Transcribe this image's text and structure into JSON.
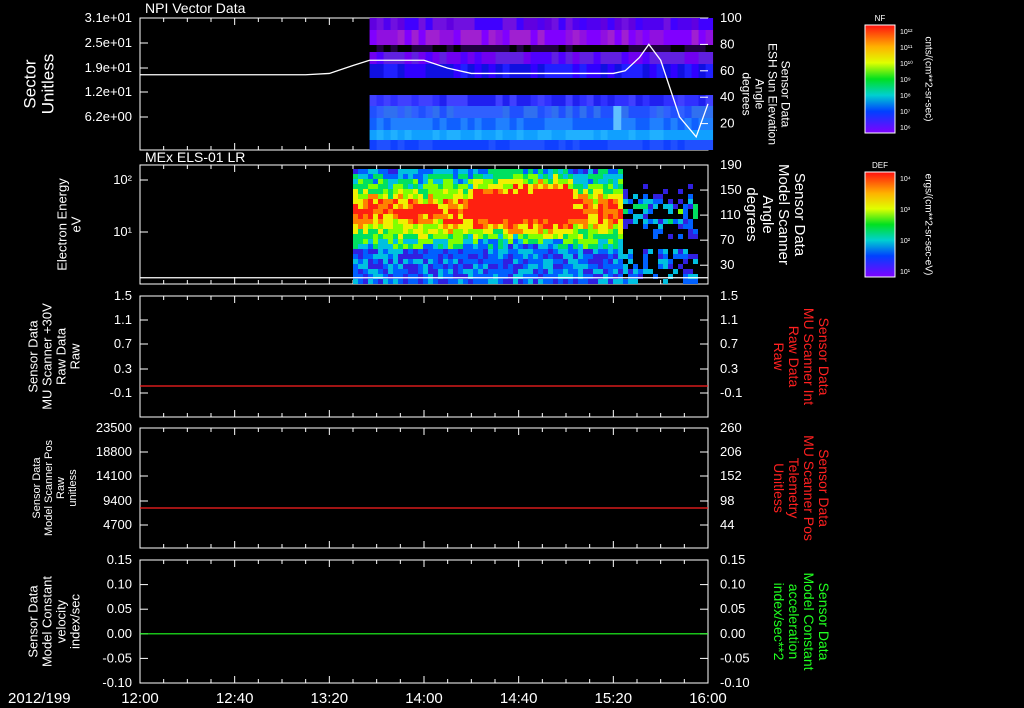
{
  "colors": {
    "background": "#000000",
    "axis": "#ffffff",
    "red_trace": "#ff2020",
    "green_trace": "#20ff20",
    "right_red_label": "#ff2020",
    "right_green_label": "#20ff20"
  },
  "chart_data": [
    {
      "type": "heatmap",
      "title": "NPI Vector Data",
      "ylabel": [
        "Sector",
        "Unitless"
      ],
      "yticks": [
        "3.1e+01",
        "2.5e+01",
        "1.9e+01",
        "1.2e+01",
        "6.2e+00"
      ],
      "right_ylabel": [
        "Sensor Data",
        "ESH Sun Elevation",
        "Angle",
        "degrees"
      ],
      "right_yticks": [
        "100",
        "80",
        "60",
        "40",
        "20"
      ],
      "right_ylim": [
        0,
        100
      ],
      "colorbar": {
        "label": "NF",
        "ticks": [
          "10¹²",
          "10¹¹",
          "10¹⁰",
          "10⁹",
          "10⁸",
          "10⁷",
          "10⁶"
        ],
        "unit": "cnts/(cm**2-sr-sec)"
      },
      "data_start_time": "13:37",
      "line": {
        "name": "Sun Elevation Angle",
        "times": [
          "12:00",
          "13:10",
          "13:20",
          "13:30",
          "13:37",
          "14:00",
          "14:10",
          "14:20",
          "15:20",
          "15:25",
          "15:31",
          "15:35",
          "15:40",
          "15:48",
          "15:55",
          "16:00"
        ],
        "values": [
          57,
          57,
          58,
          64,
          68,
          68,
          62,
          58,
          58,
          60,
          70,
          80,
          68,
          25,
          10,
          35
        ]
      }
    },
    {
      "type": "heatmap",
      "title": "MEx ELS-01 LR",
      "ylabel": [
        "Electron Energy",
        "eV"
      ],
      "yticks": [
        "10²",
        "10¹"
      ],
      "right_ylabel": [
        "Sensor Data",
        "Model Scanner",
        "Angle",
        "degrees"
      ],
      "right_yticks": [
        "190",
        "150",
        "110",
        "70",
        "30"
      ],
      "right_ylim": [
        0,
        190
      ],
      "colorbar": {
        "label": "DEF",
        "ticks": [
          "10⁴",
          "10³",
          "10²",
          "10¹"
        ],
        "unit": "ergs/(cm**2-sr-sec-eV)"
      },
      "data_start_time": "13:30",
      "line": {
        "name": "Model Scanner Angle",
        "value": 10
      }
    },
    {
      "type": "line",
      "ylabel": [
        "Sensor Data",
        "MU Scanner +30V",
        "Raw Data",
        "Raw"
      ],
      "yticks": [
        "1.5",
        "1.1",
        "0.7",
        "0.3",
        "-0.1"
      ],
      "ylim": [
        -0.3,
        1.5
      ],
      "right_ylabel": [
        "Sensor Data",
        "MU Scanner Int",
        "Raw Data",
        "Raw"
      ],
      "right_yticks": [
        "1.5",
        "1.1",
        "0.7",
        "0.3",
        "-0.1"
      ],
      "series": [
        {
          "value": 0.0,
          "color": "#ff2020"
        }
      ]
    },
    {
      "type": "line",
      "ylabel": [
        "Sensor Data",
        "Model Scanner Pos",
        "Raw",
        "unitless"
      ],
      "yticks": [
        "23500",
        "18800",
        "14100",
        "9400",
        "4700"
      ],
      "ylim": [
        0,
        23500
      ],
      "right_ylabel": [
        "Sensor Data",
        "MU Scanner Pos",
        "Telemetry",
        "Unitless"
      ],
      "right_yticks": [
        "260",
        "206",
        "152",
        "98",
        "44"
      ],
      "series": [
        {
          "value": 8000,
          "color": "#ff2020"
        }
      ]
    },
    {
      "type": "line",
      "ylabel": [
        "Sensor Data",
        "Model Constant",
        "velocity",
        "index/sec"
      ],
      "yticks": [
        "0.15",
        "0.10",
        "0.05",
        "0.00",
        "-0.05",
        "-0.10"
      ],
      "ylim": [
        -0.1,
        0.15
      ],
      "right_ylabel": [
        "Sensor Data",
        "Model Constant",
        "acceleration",
        "index/sec**2"
      ],
      "right_yticks": [
        "0.15",
        "0.10",
        "0.05",
        "0.00",
        "-0.05",
        "-0.10"
      ],
      "series": [
        {
          "value": 0.0,
          "color": "#20ff20"
        }
      ]
    }
  ],
  "time_axis": {
    "date": "2012/199",
    "ticks": [
      "12:00",
      "12:40",
      "13:20",
      "14:00",
      "14:40",
      "15:20",
      "16:00"
    ]
  }
}
